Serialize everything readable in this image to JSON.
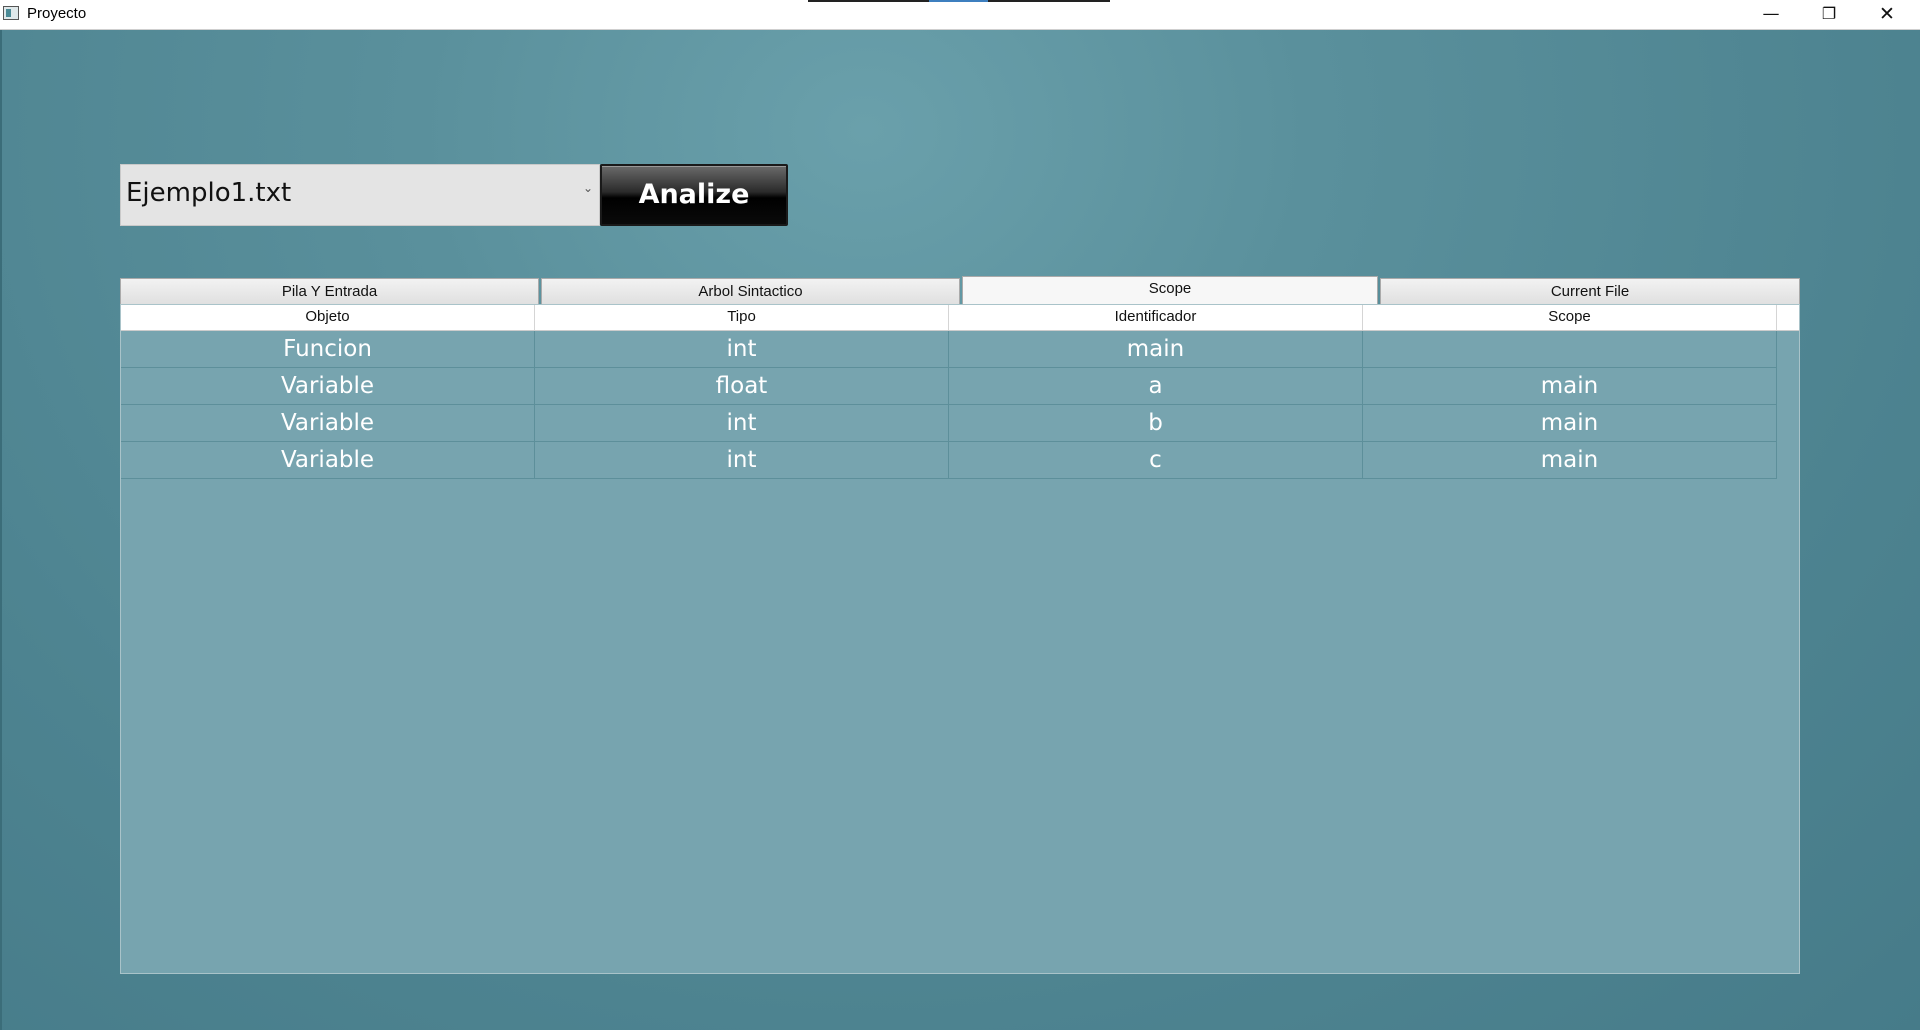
{
  "window": {
    "title": "Proyecto",
    "minimize_icon": "minimize-icon",
    "maximize_icon": "restore-icon",
    "close_icon": "close-icon",
    "minimize_glyph": "—",
    "maximize_glyph": "❐",
    "close_glyph": "✕"
  },
  "toolbar": {
    "file_select_value": "Ejemplo1.txt",
    "analyze_label": "Analize",
    "chevron_glyph": "⌄"
  },
  "tabs": [
    {
      "label": "Pila Y Entrada",
      "active": false
    },
    {
      "label": "Arbol Sintactico",
      "active": false
    },
    {
      "label": "Scope",
      "active": true
    },
    {
      "label": "Current File",
      "active": false
    }
  ],
  "grid": {
    "columns": [
      "Objeto",
      "Tipo",
      "Identificador",
      "Scope"
    ],
    "rows": [
      [
        "Funcion",
        "int",
        "main",
        ""
      ],
      [
        "Variable",
        "float",
        "a",
        "main"
      ],
      [
        "Variable",
        "int",
        "b",
        "main"
      ],
      [
        "Variable",
        "int",
        "c",
        "main"
      ]
    ]
  },
  "colors": {
    "background": "#4a7f8d",
    "grid_background": "#77a4af",
    "analyze_button": "#000000"
  }
}
